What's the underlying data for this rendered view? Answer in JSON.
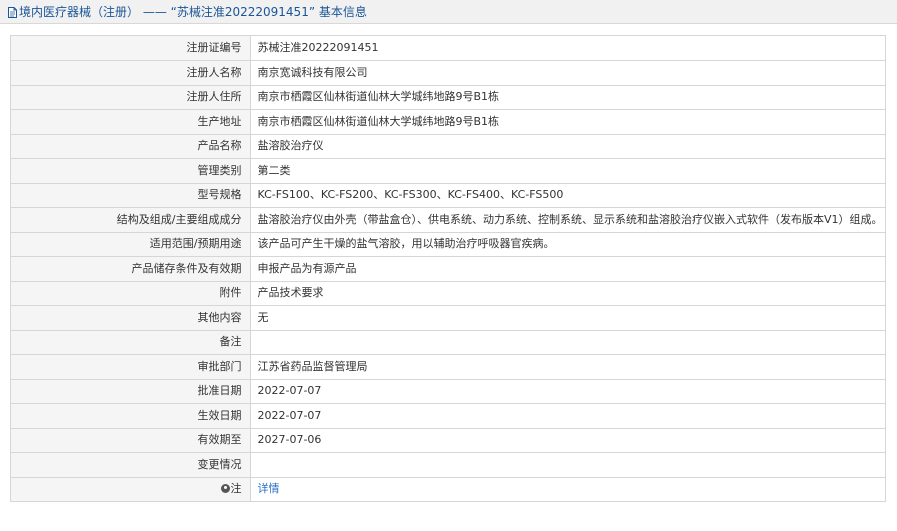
{
  "header": {
    "title": "境内医疗器械（注册） —— “苏械注准20222091451” 基本信息"
  },
  "rows": [
    {
      "label": "注册证编号",
      "value": "苏械注准20222091451"
    },
    {
      "label": "注册人名称",
      "value": "南京宽诚科技有限公司"
    },
    {
      "label": "注册人住所",
      "value": "南京市栖霞区仙林街道仙林大学城纬地路9号B1栋"
    },
    {
      "label": "生产地址",
      "value": "南京市栖霞区仙林街道仙林大学城纬地路9号B1栋"
    },
    {
      "label": "产品名称",
      "value": "盐溶胶治疗仪"
    },
    {
      "label": "管理类别",
      "value": "第二类"
    },
    {
      "label": "型号规格",
      "value": "KC-FS100、KC-FS200、KC-FS300、KC-FS400、KC-FS500"
    },
    {
      "label": "结构及组成/主要组成成分",
      "value": "盐溶胶治疗仪由外壳（带盐盒仓）、供电系统、动力系统、控制系统、显示系统和盐溶胶治疗仪嵌入式软件（发布版本V1）组成。"
    },
    {
      "label": "适用范围/预期用途",
      "value": "该产品可产生干燥的盐气溶胶，用以辅助治疗呼吸器官疾病。"
    },
    {
      "label": "产品储存条件及有效期",
      "value": "申报产品为有源产品"
    },
    {
      "label": "附件",
      "value": "产品技术要求"
    },
    {
      "label": "其他内容",
      "value": "无"
    },
    {
      "label": "备注",
      "value": ""
    },
    {
      "label": "审批部门",
      "value": "江苏省药品监督管理局"
    },
    {
      "label": "批准日期",
      "value": "2022-07-07"
    },
    {
      "label": "生效日期",
      "value": "2022-07-07"
    },
    {
      "label": "有效期至",
      "value": "2027-07-06"
    },
    {
      "label": "变更情况",
      "value": ""
    }
  ],
  "note_row": {
    "label": "注",
    "link_text": "详情",
    "icon": "pin-icon"
  },
  "colors": {
    "title": "#1a5597",
    "link": "#2a6fc9",
    "label_bg": "#f5f5f5",
    "border": "#d6d6d6"
  }
}
